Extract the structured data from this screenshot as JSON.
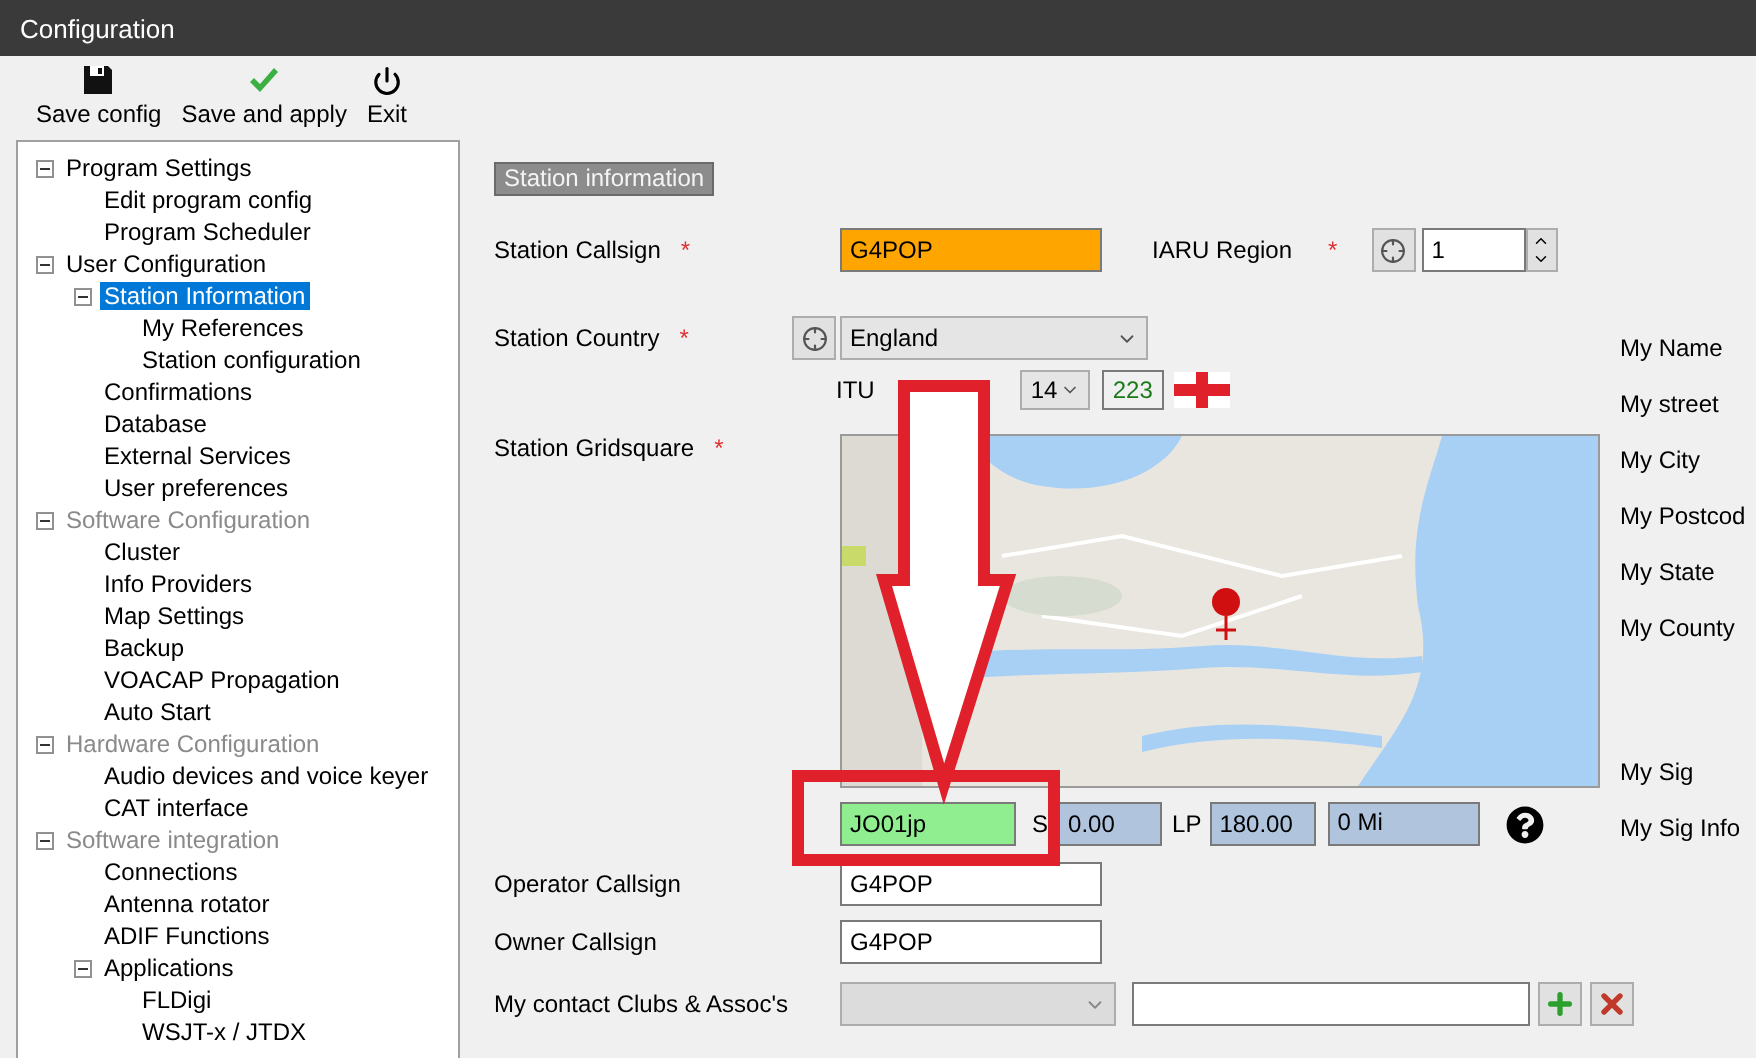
{
  "window": {
    "title": "Configuration"
  },
  "toolbar": [
    {
      "label": "Save config",
      "kind": "save"
    },
    {
      "label": "Save and apply",
      "kind": "apply"
    },
    {
      "label": "Exit",
      "kind": "exit"
    }
  ],
  "tree": [
    {
      "label": "Program Settings",
      "selected": false,
      "disabled": false,
      "expanded": true,
      "children": [
        {
          "label": "Edit program config",
          "selected": false,
          "disabled": false
        },
        {
          "label": "Program Scheduler",
          "selected": false,
          "disabled": false
        }
      ]
    },
    {
      "label": "User Configuration",
      "selected": false,
      "disabled": false,
      "expanded": true,
      "children": [
        {
          "label": "Station Information",
          "selected": true,
          "disabled": false,
          "expanded": true,
          "children": [
            {
              "label": "My References",
              "selected": false,
              "disabled": false
            },
            {
              "label": "Station configuration",
              "selected": false,
              "disabled": false
            }
          ]
        },
        {
          "label": "Confirmations",
          "selected": false,
          "disabled": false
        },
        {
          "label": "Database",
          "selected": false,
          "disabled": false
        },
        {
          "label": "External Services",
          "selected": false,
          "disabled": false
        },
        {
          "label": "User preferences",
          "selected": false,
          "disabled": false
        }
      ]
    },
    {
      "label": "Software Configuration",
      "selected": false,
      "disabled": true,
      "expanded": true,
      "children": [
        {
          "label": "Cluster",
          "selected": false,
          "disabled": false
        },
        {
          "label": "Info Providers",
          "selected": false,
          "disabled": false
        },
        {
          "label": "Map Settings",
          "selected": false,
          "disabled": false
        },
        {
          "label": "Backup",
          "selected": false,
          "disabled": false
        },
        {
          "label": "VOACAP Propagation",
          "selected": false,
          "disabled": false
        },
        {
          "label": "Auto Start",
          "selected": false,
          "disabled": false
        }
      ]
    },
    {
      "label": "Hardware Configuration",
      "selected": false,
      "disabled": true,
      "expanded": true,
      "children": [
        {
          "label": "Audio devices and voice keyer",
          "selected": false,
          "disabled": false
        },
        {
          "label": "CAT interface",
          "selected": false,
          "disabled": false
        }
      ]
    },
    {
      "label": "Software integration",
      "selected": false,
      "disabled": true,
      "expanded": true,
      "children": [
        {
          "label": "Connections",
          "selected": false,
          "disabled": false
        },
        {
          "label": "Antenna rotator",
          "selected": false,
          "disabled": false
        },
        {
          "label": "ADIF Functions",
          "selected": false,
          "disabled": false
        },
        {
          "label": "Applications",
          "selected": false,
          "disabled": false,
          "expanded": true,
          "children": [
            {
              "label": "FLDigi",
              "selected": false,
              "disabled": false
            },
            {
              "label": "WSJT-x / JTDX",
              "selected": false,
              "disabled": false
            }
          ]
        }
      ]
    }
  ],
  "section_title": "Station information",
  "station_callsign": {
    "label": "Station Callsign",
    "required_mark": "*",
    "value": "G4POP"
  },
  "iaru_region": {
    "label": "IARU Region",
    "required_mark": "*",
    "value": "1"
  },
  "station_country": {
    "label": "Station Country",
    "required_mark": "*",
    "value": "England"
  },
  "itu": {
    "label": "ITU"
  },
  "cq": {
    "value": "14"
  },
  "dxcc": "223",
  "station_gridsquare": {
    "label": "Station Gridsquare",
    "required_mark": "*"
  },
  "locator": {
    "value": "JO01jp",
    "sp_label": "S",
    "sp": "0.00",
    "lp_label": "LP",
    "lp": "180.00",
    "distance": "0 Mi"
  },
  "operator_callsign": {
    "label": "Operator Callsign",
    "value": "G4POP"
  },
  "owner_callsign": {
    "label": "Owner Callsign",
    "value": "G4POP"
  },
  "clubs": {
    "label": "My contact Clubs & Assoc's",
    "disabled": true
  },
  "right_labels": [
    "My Name",
    "My street",
    "My City",
    "My Postcod",
    "My State",
    "My County",
    "My Sig",
    "My Sig Info"
  ]
}
